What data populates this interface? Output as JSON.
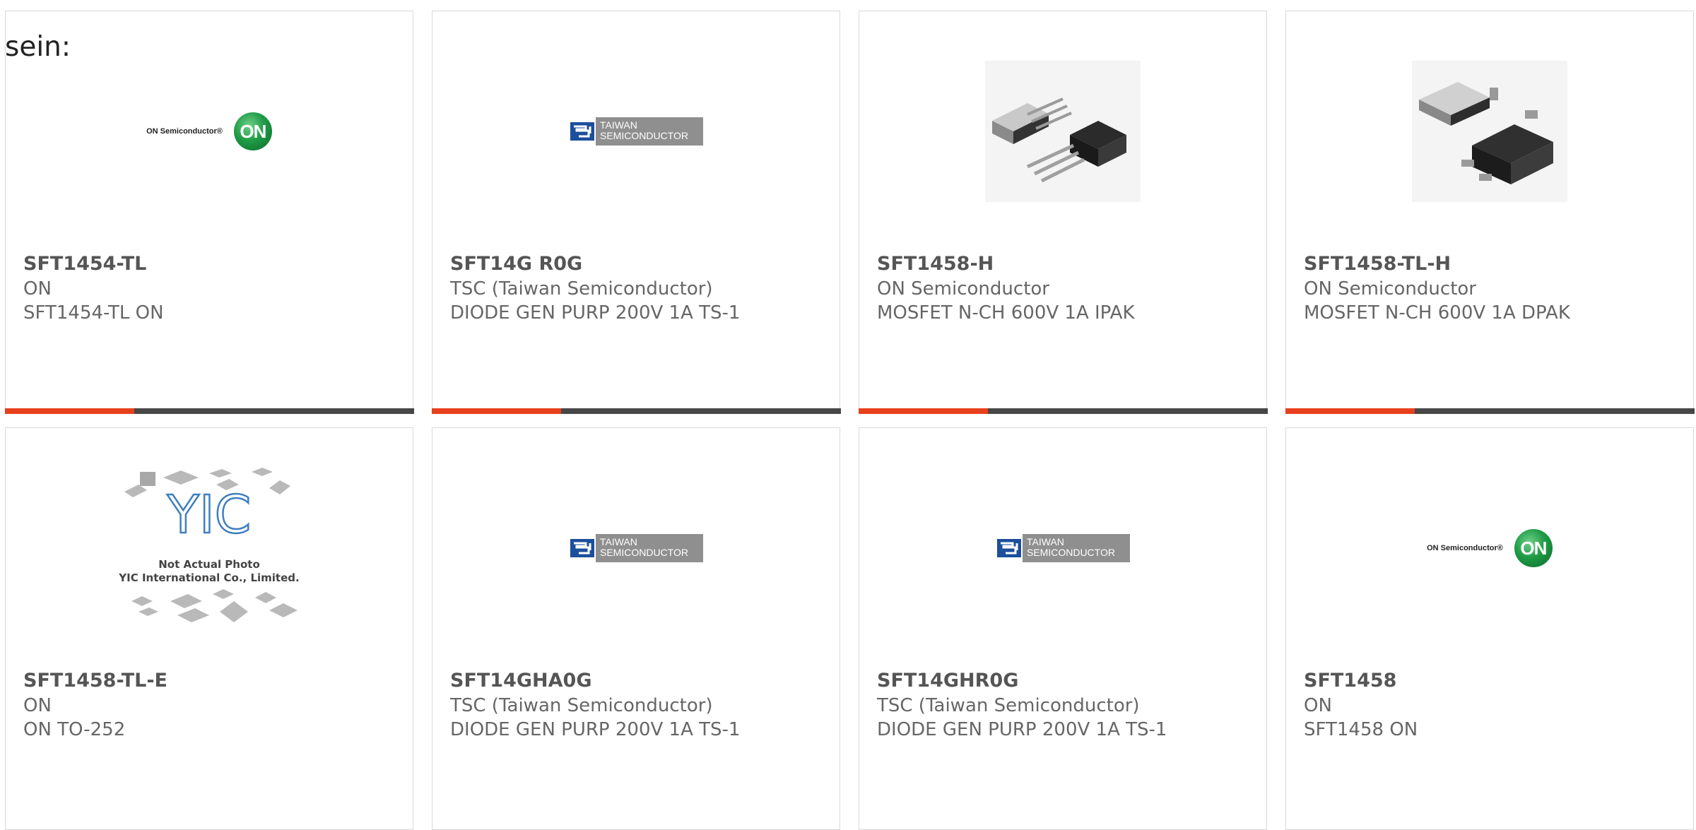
{
  "lead_text": "sein:",
  "colors": {
    "accent": "#e8401c",
    "bar": "#474747",
    "border": "#d9d9d9"
  },
  "cards": [
    {
      "part": "SFT1454-TL",
      "mfr": "ON",
      "desc": "SFT1454-TL ON",
      "image": "on-semiconductor-logo",
      "logo_text": "ON Semiconductor®",
      "logo_mark": "ON"
    },
    {
      "part": "SFT14G R0G",
      "mfr": "TSC (Taiwan Semiconductor)",
      "desc": "DIODE GEN PURP 200V 1A TS-1",
      "image": "taiwan-semiconductor-logo",
      "logo_line1": "TAIWAN",
      "logo_line2": "SEMICONDUCTOR"
    },
    {
      "part": "SFT1458-H",
      "mfr": "ON Semiconductor",
      "desc": "MOSFET N-CH 600V 1A IPAK",
      "image": "ipak-package-photo"
    },
    {
      "part": "SFT1458-TL-H",
      "mfr": "ON Semiconductor",
      "desc": "MOSFET N-CH 600V 1A DPAK",
      "image": "dpak-package-photo"
    },
    {
      "part": "SFT1458-TL-E",
      "mfr": "ON",
      "desc": "ON TO-252",
      "image": "yic-placeholder-photo",
      "logo_line1": "Not Actual Photo",
      "logo_line2": "YIC International Co., Limited."
    },
    {
      "part": "SFT14GHA0G",
      "mfr": "TSC (Taiwan Semiconductor)",
      "desc": "DIODE GEN PURP 200V 1A TS-1",
      "image": "taiwan-semiconductor-logo",
      "logo_line1": "TAIWAN",
      "logo_line2": "SEMICONDUCTOR"
    },
    {
      "part": "SFT14GHR0G",
      "mfr": "TSC (Taiwan Semiconductor)",
      "desc": "DIODE GEN PURP 200V 1A TS-1",
      "image": "taiwan-semiconductor-logo",
      "logo_line1": "TAIWAN",
      "logo_line2": "SEMICONDUCTOR"
    },
    {
      "part": "SFT1458",
      "mfr": "ON",
      "desc": "SFT1458 ON",
      "image": "on-semiconductor-logo",
      "logo_text": "ON Semiconductor®",
      "logo_mark": "ON"
    }
  ]
}
